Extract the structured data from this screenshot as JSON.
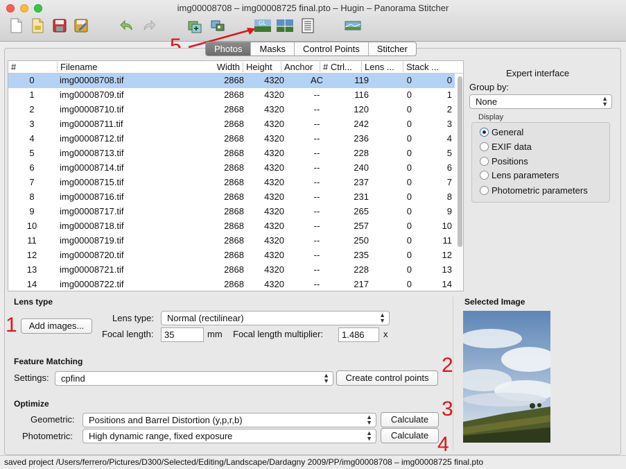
{
  "window": {
    "title": "img00008708 – img00008725 final.pto – Hugin – Panorama Stitcher"
  },
  "toolbar": {
    "icons": [
      "new-icon",
      "open-icon",
      "save-icon",
      "save-as-icon",
      "undo-icon",
      "redo-icon",
      "add-images-icon",
      "assistant-icon",
      "gl-preview-icon",
      "preview-icon",
      "batch-icon",
      "stitch-icon"
    ],
    "gl_label": "GL"
  },
  "tabs": [
    {
      "label": "Photos",
      "active": true
    },
    {
      "label": "Masks",
      "active": false
    },
    {
      "label": "Control Points",
      "active": false
    },
    {
      "label": "Stitcher",
      "active": false
    }
  ],
  "table": {
    "columns": [
      "#",
      "Filename",
      "Width",
      "Height",
      "Anchor",
      "# Ctrl...",
      "Lens ...",
      "Stack ..."
    ],
    "rows": [
      [
        "0",
        "img00008708.tif",
        "2868",
        "4320",
        "AC",
        "119",
        "0",
        "0"
      ],
      [
        "1",
        "img00008709.tif",
        "2868",
        "4320",
        "--",
        "116",
        "0",
        "1"
      ],
      [
        "2",
        "img00008710.tif",
        "2868",
        "4320",
        "--",
        "120",
        "0",
        "2"
      ],
      [
        "3",
        "img00008711.tif",
        "2868",
        "4320",
        "--",
        "242",
        "0",
        "3"
      ],
      [
        "4",
        "img00008712.tif",
        "2868",
        "4320",
        "--",
        "236",
        "0",
        "4"
      ],
      [
        "5",
        "img00008713.tif",
        "2868",
        "4320",
        "--",
        "228",
        "0",
        "5"
      ],
      [
        "6",
        "img00008714.tif",
        "2868",
        "4320",
        "--",
        "240",
        "0",
        "6"
      ],
      [
        "7",
        "img00008715.tif",
        "2868",
        "4320",
        "--",
        "237",
        "0",
        "7"
      ],
      [
        "8",
        "img00008716.tif",
        "2868",
        "4320",
        "--",
        "231",
        "0",
        "8"
      ],
      [
        "9",
        "img00008717.tif",
        "2868",
        "4320",
        "--",
        "265",
        "0",
        "9"
      ],
      [
        "10",
        "img00008718.tif",
        "2868",
        "4320",
        "--",
        "257",
        "0",
        "10"
      ],
      [
        "11",
        "img00008719.tif",
        "2868",
        "4320",
        "--",
        "250",
        "0",
        "11"
      ],
      [
        "12",
        "img00008720.tif",
        "2868",
        "4320",
        "--",
        "235",
        "0",
        "12"
      ],
      [
        "13",
        "img00008721.tif",
        "2868",
        "4320",
        "--",
        "228",
        "0",
        "13"
      ],
      [
        "14",
        "img00008722.tif",
        "2868",
        "4320",
        "--",
        "217",
        "0",
        "14"
      ]
    ],
    "selected_row": 0
  },
  "side": {
    "expert": "Expert interface",
    "group_by_label": "Group by:",
    "group_by_value": "None",
    "display_label": "Display",
    "display_options": [
      "General",
      "EXIF data",
      "Positions",
      "Lens parameters",
      "Photometric parameters"
    ],
    "display_selected": 0
  },
  "lens": {
    "section": "Lens type",
    "add_images": "Add images...",
    "lens_type_label": "Lens type:",
    "lens_type_value": "Normal (rectilinear)",
    "focal_label": "Focal length:",
    "focal_value": "35",
    "focal_unit": "mm",
    "multiplier_label": "Focal length multiplier:",
    "multiplier_value": "1.486",
    "multiplier_unit": "x"
  },
  "feature": {
    "section": "Feature Matching",
    "settings_label": "Settings:",
    "settings_value": "cpfind",
    "create_button": "Create control points"
  },
  "optimize": {
    "section": "Optimize",
    "geometric_label": "Geometric:",
    "geometric_value": "Positions and Barrel Distortion (y,p,r,b)",
    "photometric_label": "Photometric:",
    "photometric_value": "High dynamic range, fixed exposure",
    "calculate": "Calculate"
  },
  "selected_image": {
    "label": "Selected Image"
  },
  "annotations": [
    "1",
    "2",
    "3",
    "4",
    "5"
  ],
  "status": {
    "text": "saved project /Users/ferrero/Pictures/D300/Selected/Editing/Landscape/Dardagny 2009/PP/img00008708 – img00008725 final.pto"
  },
  "colors": {
    "selection": "#b4d2f4",
    "annotation": "#e0141c",
    "active_tab": "#7a7a7a"
  }
}
